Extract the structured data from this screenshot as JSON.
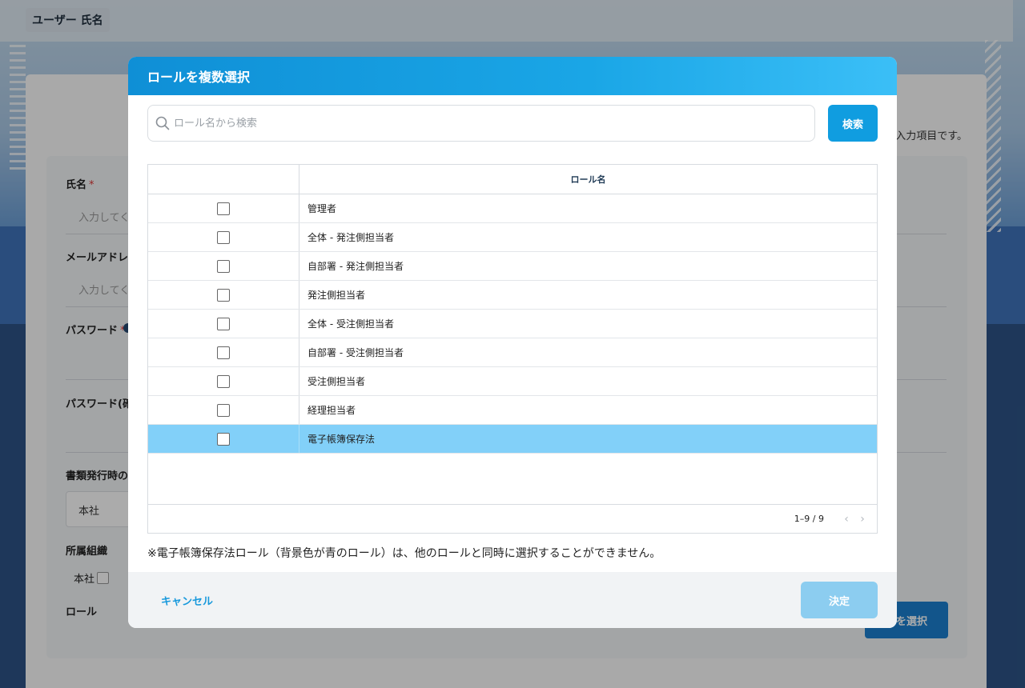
{
  "page": {
    "title": "ユーザー 氏名",
    "required_note": "入力項目です。",
    "fields": {
      "name_label": "氏名",
      "name_placeholder": "入力してくだ",
      "email_label": "メールアドレス",
      "email_placeholder": "入力してくだ",
      "password_label": "パスワード",
      "password_confirm_label": "パスワード(確認",
      "office_label": "書類発行時の",
      "office_value": "本社",
      "org_label": "所属組織",
      "org_item": "本社",
      "role_label": "ロール",
      "required_mark": "*"
    },
    "role_select_button": "ルを選択"
  },
  "modal": {
    "title": "ロールを複数選択",
    "search": {
      "placeholder": "ロール名から検索",
      "button": "検索"
    },
    "table": {
      "column_header": "ロール名",
      "rows": [
        {
          "label": "管理者",
          "checked": false,
          "highlight": false
        },
        {
          "label": "全体 - 発注側担当者",
          "checked": false,
          "highlight": false
        },
        {
          "label": "自部署 - 発注側担当者",
          "checked": false,
          "highlight": false
        },
        {
          "label": "発注側担当者",
          "checked": false,
          "highlight": false
        },
        {
          "label": "全体 - 受注側担当者",
          "checked": false,
          "highlight": false
        },
        {
          "label": "自部署 - 受注側担当者",
          "checked": false,
          "highlight": false
        },
        {
          "label": "受注側担当者",
          "checked": false,
          "highlight": false
        },
        {
          "label": "経理担当者",
          "checked": false,
          "highlight": false
        },
        {
          "label": "電子帳簿保存法",
          "checked": false,
          "highlight": true
        }
      ],
      "pagination": "1–9 / 9"
    },
    "note": "※電子帳簿保存法ロール（背景色が青のロール）は、他のロールと同時に選択することができません。",
    "cancel": "キャンセル",
    "confirm": "決定"
  },
  "colors": {
    "header_start": "#0f8fd6",
    "header_end": "#3bbff7",
    "primary": "#109de0",
    "highlight_row": "#82d0f9",
    "confirm_disabled": "#8ccdf0"
  }
}
